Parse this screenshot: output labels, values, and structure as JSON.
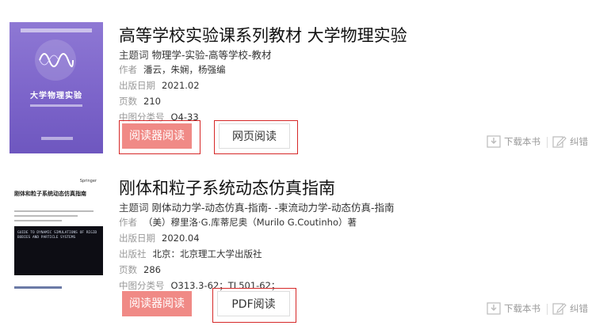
{
  "books": [
    {
      "title": "高等学校实验课系列教材 大学物理实验",
      "subject_label": "主题词",
      "subject_value": "物理学-实验-高等学校-教材",
      "cover": {
        "title": "大学物理实验",
        "bg_color": "#7b63c9"
      },
      "fields": [
        {
          "label": "作者",
          "value": "潘云，朱娴，杨强编"
        },
        {
          "label": "出版日期",
          "value": "2021.02"
        },
        {
          "label": "页数",
          "value": "210"
        },
        {
          "label": "中图分类号",
          "value": "O4-33"
        }
      ],
      "buttons": {
        "reader": "阅读器阅读",
        "secondary": "网页阅读"
      },
      "actions": {
        "download": "下载本书",
        "correct": "纠错"
      }
    },
    {
      "title": "刚体和粒子系统动态仿真指南",
      "subject_label": "主题词",
      "subject_value": "刚体动力学-动态仿真-指南- -柬流动力学-动态仿真-指南",
      "cover": {
        "title": "刚体和粒子系统动态仿真指南",
        "publisher_mark": "Springer",
        "english_title": "GUIDE TO DYNAMIC SIMULATIONS OF RIGID BODIES AND PARTICLE SYSTEMS"
      },
      "fields": [
        {
          "label": "作者",
          "value": "（美）穆里洛·G.库蒂尼奥（Murilo G.Coutinho）著"
        },
        {
          "label": "出版日期",
          "value": "2020.04"
        },
        {
          "label": "出版社",
          "value": "北京：北京理工大学出版社"
        },
        {
          "label": "页数",
          "value": "286"
        },
        {
          "label": "中图分类号",
          "value": "O313.3-62；TL501-62；"
        }
      ],
      "buttons": {
        "reader": "阅读器阅读",
        "secondary": "PDF阅读"
      },
      "actions": {
        "download": "下载本书",
        "correct": "纠错"
      }
    }
  ],
  "colors": {
    "reader_button": "#f08a86",
    "highlight_border": "#d62828",
    "meta_label": "#999999"
  }
}
